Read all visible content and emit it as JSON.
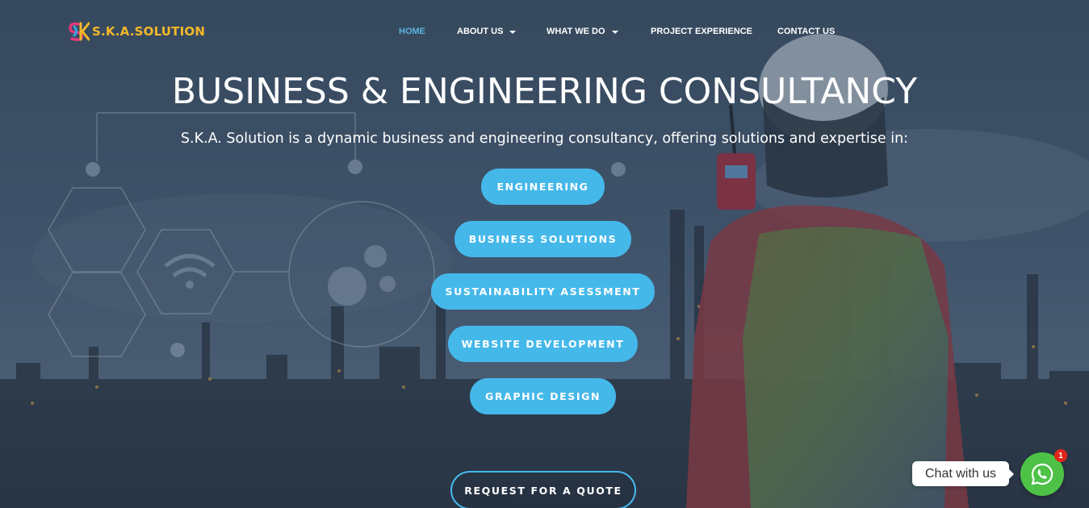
{
  "brand": {
    "logo_text": "S.K.A.SOLUTION",
    "logo_icon": "ska-logo-icon",
    "accent": "#f2b829"
  },
  "nav": {
    "items": [
      {
        "label": "HOME",
        "active": true,
        "dropdown": false
      },
      {
        "label": "ABOUT US",
        "active": false,
        "dropdown": true
      },
      {
        "label": "WHAT WE DO",
        "active": false,
        "dropdown": true
      },
      {
        "label": "PROJECT EXPERIENCE",
        "active": false,
        "dropdown": false
      },
      {
        "label": "CONTACT US",
        "active": false,
        "dropdown": false
      }
    ],
    "active_color": "#5ab4e0"
  },
  "hero": {
    "title": "BUSINESS & ENGINEERING CONSULTANCY",
    "subtitle": "S.K.A. Solution is a dynamic business and engineering consultancy, offering solutions and expertise in:",
    "services": [
      "ENGINEERING",
      "BUSINESS SOLUTIONS",
      "SUSTAINABILITY ASESSMENT",
      "WEBSITE DEVELOPMENT",
      "GRAPHIC DESIGN"
    ],
    "cta": "REQUEST FOR A QUOTE",
    "button_color": "#45b8ea"
  },
  "chat": {
    "label": "Chat with us",
    "icon": "whatsapp-icon",
    "badge_count": "1",
    "color": "#4dc247"
  }
}
